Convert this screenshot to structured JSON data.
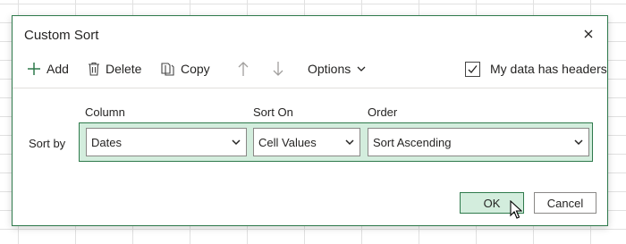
{
  "dialog": {
    "title": "Custom Sort",
    "close_icon": "close-icon"
  },
  "toolbar": {
    "add_label": "Add",
    "delete_label": "Delete",
    "copy_label": "Copy",
    "move_up_icon": "arrow-up-icon",
    "move_down_icon": "arrow-down-icon",
    "options_label": "Options",
    "headers_checkbox_label": "My data has headers",
    "headers_checked": true
  },
  "columns": {
    "column": "Column",
    "sort_on": "Sort On",
    "order": "Order"
  },
  "sort_level": {
    "label": "Sort by",
    "column_value": "Dates",
    "sort_on_value": "Cell Values",
    "order_value": "Sort Ascending"
  },
  "buttons": {
    "ok": "OK",
    "cancel": "Cancel"
  },
  "colors": {
    "accent": "#2f7a4c",
    "selection_fill": "#d3eddd"
  }
}
